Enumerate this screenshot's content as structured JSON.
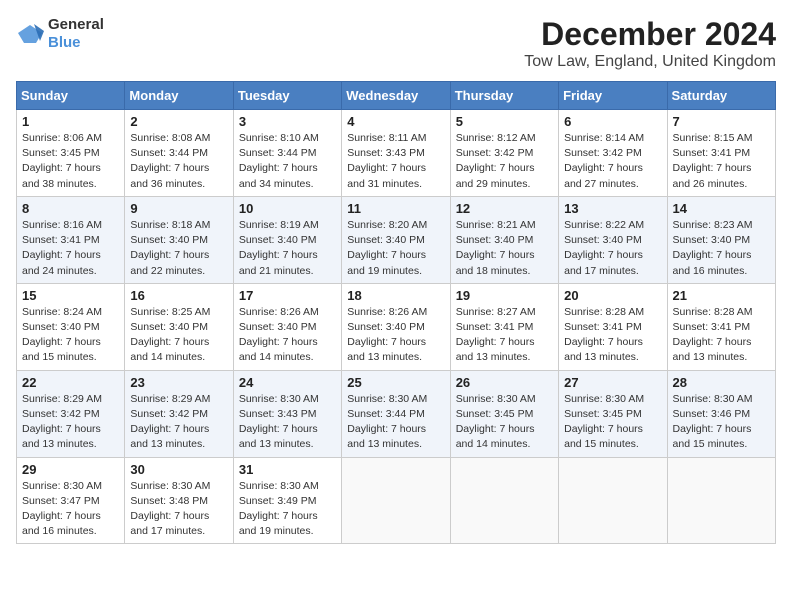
{
  "header": {
    "logo_general": "General",
    "logo_blue": "Blue",
    "month": "December 2024",
    "location": "Tow Law, England, United Kingdom"
  },
  "days_of_week": [
    "Sunday",
    "Monday",
    "Tuesday",
    "Wednesday",
    "Thursday",
    "Friday",
    "Saturday"
  ],
  "weeks": [
    [
      {
        "day": "1",
        "info": "Sunrise: 8:06 AM\nSunset: 3:45 PM\nDaylight: 7 hours\nand 38 minutes."
      },
      {
        "day": "2",
        "info": "Sunrise: 8:08 AM\nSunset: 3:44 PM\nDaylight: 7 hours\nand 36 minutes."
      },
      {
        "day": "3",
        "info": "Sunrise: 8:10 AM\nSunset: 3:44 PM\nDaylight: 7 hours\nand 34 minutes."
      },
      {
        "day": "4",
        "info": "Sunrise: 8:11 AM\nSunset: 3:43 PM\nDaylight: 7 hours\nand 31 minutes."
      },
      {
        "day": "5",
        "info": "Sunrise: 8:12 AM\nSunset: 3:42 PM\nDaylight: 7 hours\nand 29 minutes."
      },
      {
        "day": "6",
        "info": "Sunrise: 8:14 AM\nSunset: 3:42 PM\nDaylight: 7 hours\nand 27 minutes."
      },
      {
        "day": "7",
        "info": "Sunrise: 8:15 AM\nSunset: 3:41 PM\nDaylight: 7 hours\nand 26 minutes."
      }
    ],
    [
      {
        "day": "8",
        "info": "Sunrise: 8:16 AM\nSunset: 3:41 PM\nDaylight: 7 hours\nand 24 minutes."
      },
      {
        "day": "9",
        "info": "Sunrise: 8:18 AM\nSunset: 3:40 PM\nDaylight: 7 hours\nand 22 minutes."
      },
      {
        "day": "10",
        "info": "Sunrise: 8:19 AM\nSunset: 3:40 PM\nDaylight: 7 hours\nand 21 minutes."
      },
      {
        "day": "11",
        "info": "Sunrise: 8:20 AM\nSunset: 3:40 PM\nDaylight: 7 hours\nand 19 minutes."
      },
      {
        "day": "12",
        "info": "Sunrise: 8:21 AM\nSunset: 3:40 PM\nDaylight: 7 hours\nand 18 minutes."
      },
      {
        "day": "13",
        "info": "Sunrise: 8:22 AM\nSunset: 3:40 PM\nDaylight: 7 hours\nand 17 minutes."
      },
      {
        "day": "14",
        "info": "Sunrise: 8:23 AM\nSunset: 3:40 PM\nDaylight: 7 hours\nand 16 minutes."
      }
    ],
    [
      {
        "day": "15",
        "info": "Sunrise: 8:24 AM\nSunset: 3:40 PM\nDaylight: 7 hours\nand 15 minutes."
      },
      {
        "day": "16",
        "info": "Sunrise: 8:25 AM\nSunset: 3:40 PM\nDaylight: 7 hours\nand 14 minutes."
      },
      {
        "day": "17",
        "info": "Sunrise: 8:26 AM\nSunset: 3:40 PM\nDaylight: 7 hours\nand 14 minutes."
      },
      {
        "day": "18",
        "info": "Sunrise: 8:26 AM\nSunset: 3:40 PM\nDaylight: 7 hours\nand 13 minutes."
      },
      {
        "day": "19",
        "info": "Sunrise: 8:27 AM\nSunset: 3:41 PM\nDaylight: 7 hours\nand 13 minutes."
      },
      {
        "day": "20",
        "info": "Sunrise: 8:28 AM\nSunset: 3:41 PM\nDaylight: 7 hours\nand 13 minutes."
      },
      {
        "day": "21",
        "info": "Sunrise: 8:28 AM\nSunset: 3:41 PM\nDaylight: 7 hours\nand 13 minutes."
      }
    ],
    [
      {
        "day": "22",
        "info": "Sunrise: 8:29 AM\nSunset: 3:42 PM\nDaylight: 7 hours\nand 13 minutes."
      },
      {
        "day": "23",
        "info": "Sunrise: 8:29 AM\nSunset: 3:42 PM\nDaylight: 7 hours\nand 13 minutes."
      },
      {
        "day": "24",
        "info": "Sunrise: 8:30 AM\nSunset: 3:43 PM\nDaylight: 7 hours\nand 13 minutes."
      },
      {
        "day": "25",
        "info": "Sunrise: 8:30 AM\nSunset: 3:44 PM\nDaylight: 7 hours\nand 13 minutes."
      },
      {
        "day": "26",
        "info": "Sunrise: 8:30 AM\nSunset: 3:45 PM\nDaylight: 7 hours\nand 14 minutes."
      },
      {
        "day": "27",
        "info": "Sunrise: 8:30 AM\nSunset: 3:45 PM\nDaylight: 7 hours\nand 15 minutes."
      },
      {
        "day": "28",
        "info": "Sunrise: 8:30 AM\nSunset: 3:46 PM\nDaylight: 7 hours\nand 15 minutes."
      }
    ],
    [
      {
        "day": "29",
        "info": "Sunrise: 8:30 AM\nSunset: 3:47 PM\nDaylight: 7 hours\nand 16 minutes."
      },
      {
        "day": "30",
        "info": "Sunrise: 8:30 AM\nSunset: 3:48 PM\nDaylight: 7 hours\nand 17 minutes."
      },
      {
        "day": "31",
        "info": "Sunrise: 8:30 AM\nSunset: 3:49 PM\nDaylight: 7 hours\nand 19 minutes."
      },
      {
        "day": "",
        "info": ""
      },
      {
        "day": "",
        "info": ""
      },
      {
        "day": "",
        "info": ""
      },
      {
        "day": "",
        "info": ""
      }
    ]
  ]
}
